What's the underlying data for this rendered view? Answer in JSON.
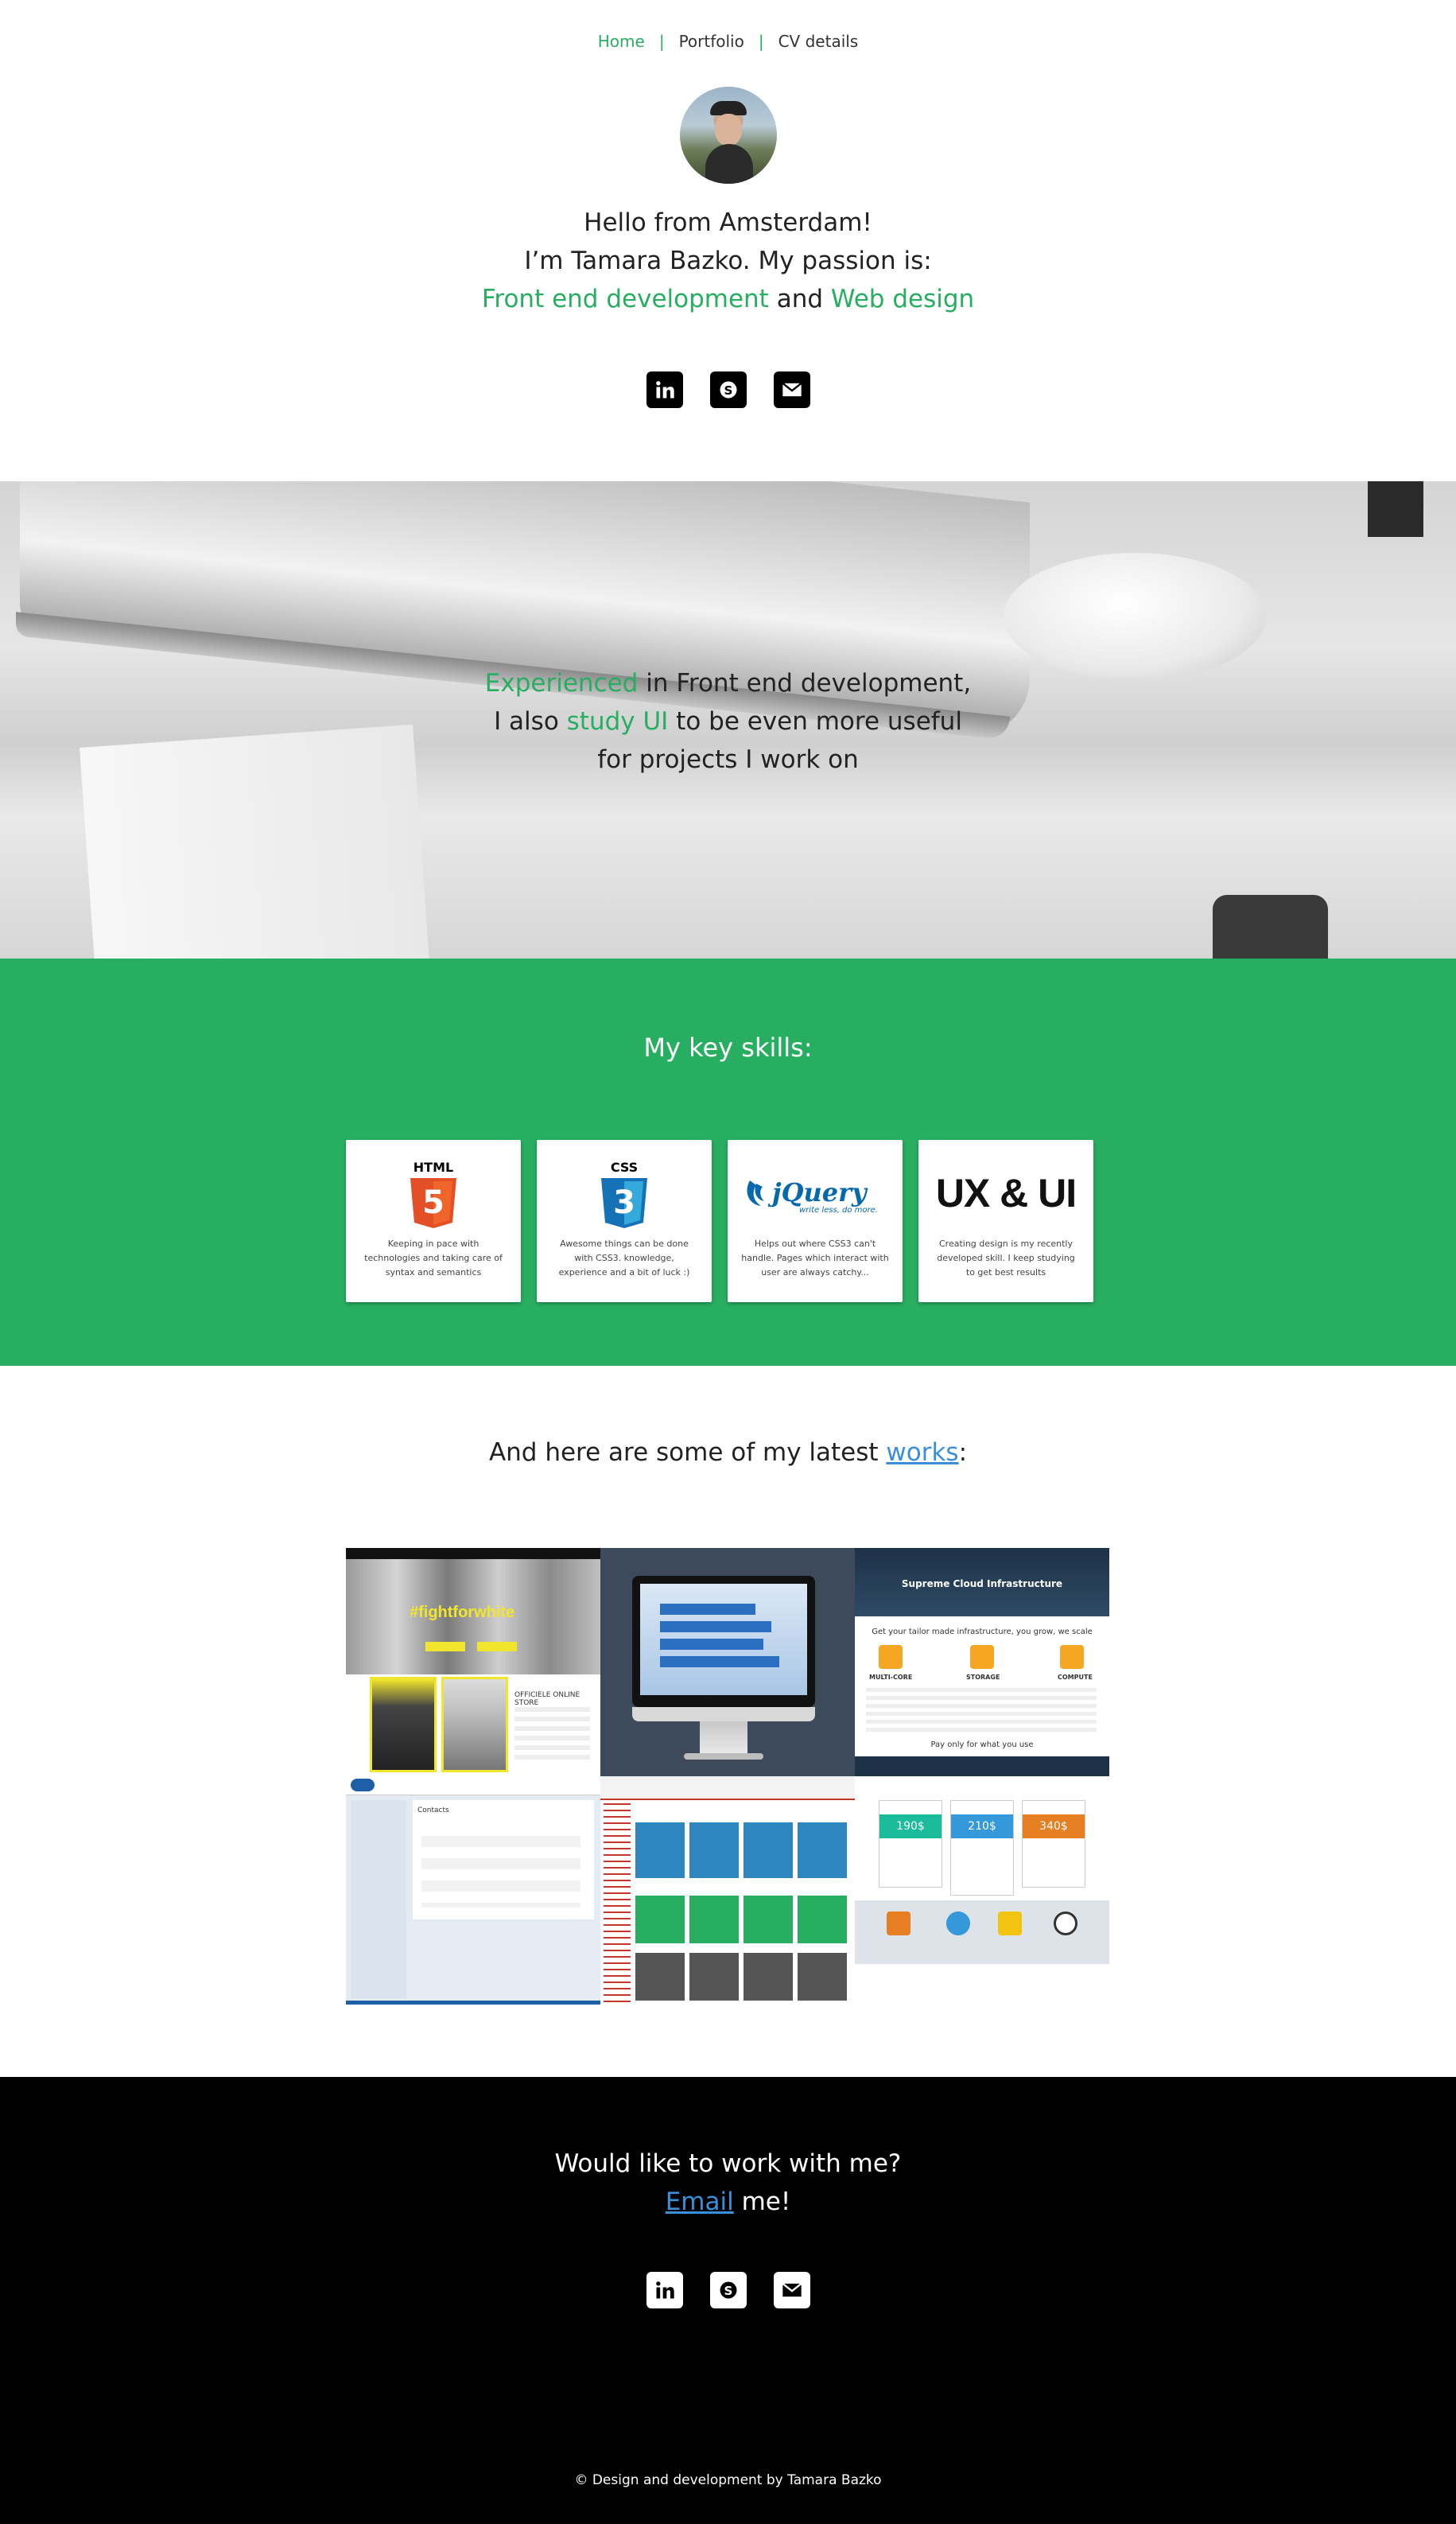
{
  "nav": {
    "items": [
      {
        "label": "Home"
      },
      {
        "label": "Portfolio"
      },
      {
        "label": "CV details"
      }
    ],
    "separator": "|"
  },
  "intro": {
    "line1": "Hello from Amsterdam!",
    "line2": "I’m Tamara Bazko. My passion is:",
    "passion1": "Front end development",
    "and": " and ",
    "passion2": "Web design"
  },
  "social_icons": [
    "linkedin-icon",
    "skype-icon",
    "email-icon"
  ],
  "hero": {
    "highlight1": "Experienced",
    "text1": " in Front end development,",
    "text2a": "I also ",
    "highlight2": "study UI",
    "text2b": " to be even more useful",
    "text3": "for projects I work on"
  },
  "skills": {
    "title": "My key skills:",
    "cards": [
      {
        "logo": "HTML",
        "badge": "5",
        "desc": "Keeping in pace with technologies and taking care of syntax and semantics"
      },
      {
        "logo": "CSS",
        "badge": "3",
        "desc": "Awesome things can be done with CSS3. knowledge, experience and a bit of luck :)"
      },
      {
        "logo": "jQuery",
        "tagline": "write less, do more.",
        "desc": "Helps out where CSS3 can't handle. Pages which interact with user are always catchy..."
      },
      {
        "logo": "UX & UI",
        "desc": "Creating design is my recently developed skill. I keep studying to get best results"
      }
    ]
  },
  "works": {
    "prefix": "And here are some of my latest ",
    "link": "works",
    "suffix": ":",
    "tiles": [
      {
        "heading": "#fightforwhite",
        "label": "OFFICIELE ONLINE STORE"
      },
      {
        "heading": "",
        "label": ""
      },
      {
        "heading": "Supreme Cloud Infrastructure",
        "label": "Get your tailor made infrastructure, you grow, we scale",
        "footer": "Pay only for what you use",
        "cols": [
          "MULTI-CORE",
          "STORAGE",
          "COMPUTE"
        ]
      },
      {
        "heading": "Contacts",
        "label": ""
      },
      {
        "heading": "",
        "label": ""
      },
      {
        "heading": "",
        "label": "",
        "prices": [
          "190$",
          "210$",
          "340$"
        ]
      }
    ]
  },
  "footer": {
    "cta1": "Would like to work with me?",
    "cta_link": "Email",
    "cta2": " me!",
    "copyright": "© Design and development by Tamara Bazko"
  },
  "colors": {
    "accent": "#27ae60",
    "link": "#3a8fd8",
    "footer_bg": "#000000"
  }
}
